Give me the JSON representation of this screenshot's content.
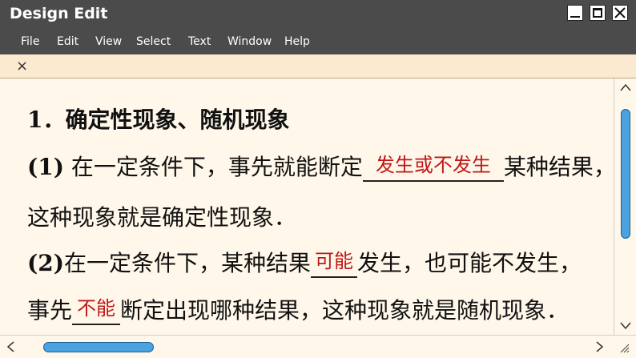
{
  "window": {
    "title": "Design Edit"
  },
  "menu": [
    "File",
    "Edit",
    "View",
    "Select",
    "Text",
    "Window",
    "Help"
  ],
  "tab": {
    "close_glyph": "×"
  },
  "doc": {
    "line1": "1．确定性现象、随机现象",
    "line2_prefix": "(1)",
    "line2_text": " 在一定条件下，事先就能断定",
    "line2_answer": "发生或不发生",
    "line2_suffix": "某种结果，",
    "line3": "这种现象就是确定性现象．",
    "line4_prefix": "(2)",
    "line4_text": "在一定条件下，某种结果",
    "line4_answer": "可能",
    "line4_suffix": "发生，也可能不发生，",
    "line5_text": "事先",
    "line5_answer": "不能",
    "line5_suffix": "断定出现哪种结果，这种现象就是随机现象．"
  },
  "colors": {
    "answer": "#c01818",
    "thumb": "#4aa3e0",
    "chrome": "#4b4b4b",
    "page": "#fff8ea"
  }
}
